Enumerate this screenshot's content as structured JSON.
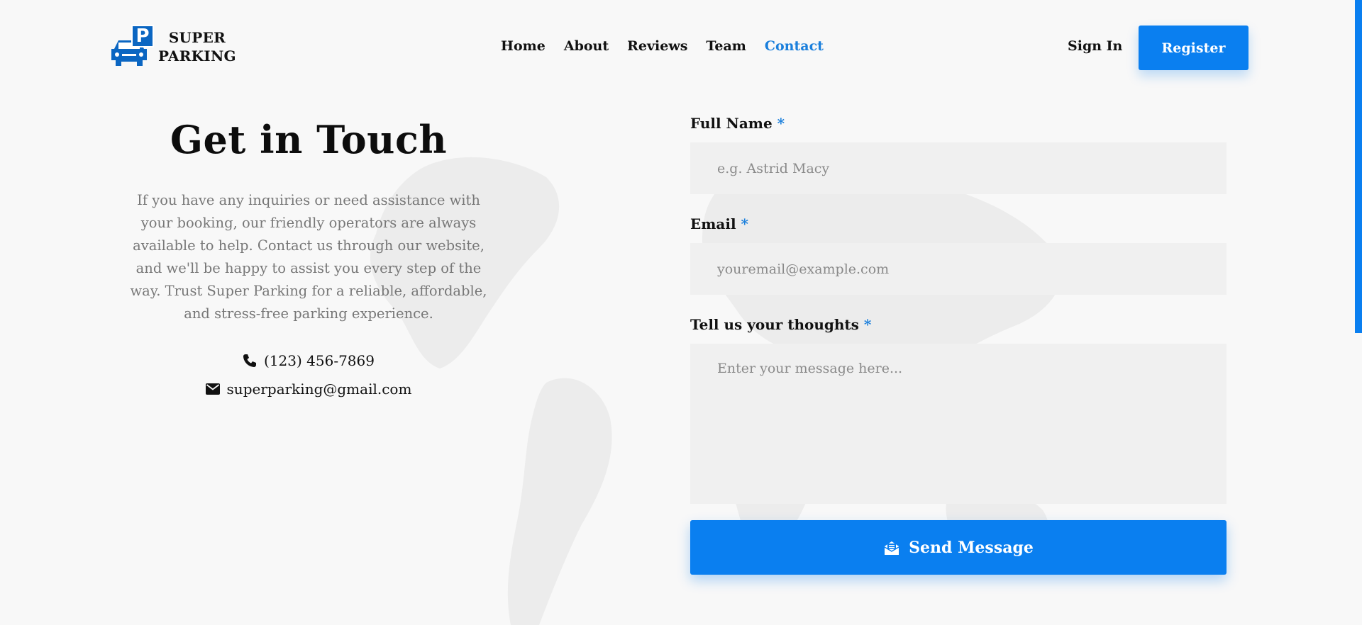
{
  "brand": {
    "line1": "SUPER",
    "line2": "PARKING",
    "logo_letter": "P",
    "accent": "#0a7ff0"
  },
  "nav": {
    "items": [
      {
        "label": "Home"
      },
      {
        "label": "About"
      },
      {
        "label": "Reviews"
      },
      {
        "label": "Team"
      },
      {
        "label": "Contact",
        "active": true
      }
    ],
    "sign_in": "Sign In",
    "register": "Register"
  },
  "contact": {
    "title": "Get in Touch",
    "description": "If you have any inquiries or need assistance with your booking, our friendly operators are always available to help. Contact us through our website, and we'll be happy to assist you every step of the way. Trust Super Parking for a reliable, affordable, and stress-free parking experience.",
    "phone": "(123) 456-7869",
    "email": "superparking@gmail.com"
  },
  "form": {
    "full_name": {
      "label": "Full Name",
      "required_mark": "*",
      "placeholder": "e.g. Astrid Macy"
    },
    "email": {
      "label": "Email",
      "required_mark": "*",
      "placeholder": "youremail@example.com"
    },
    "message": {
      "label": "Tell us your thoughts",
      "required_mark": "*",
      "placeholder": "Enter your message here..."
    },
    "submit": "Send Message"
  },
  "icons": {
    "phone": "phone-icon",
    "email": "envelope-icon",
    "send": "envelope-open-icon",
    "logo": "car-icon"
  }
}
